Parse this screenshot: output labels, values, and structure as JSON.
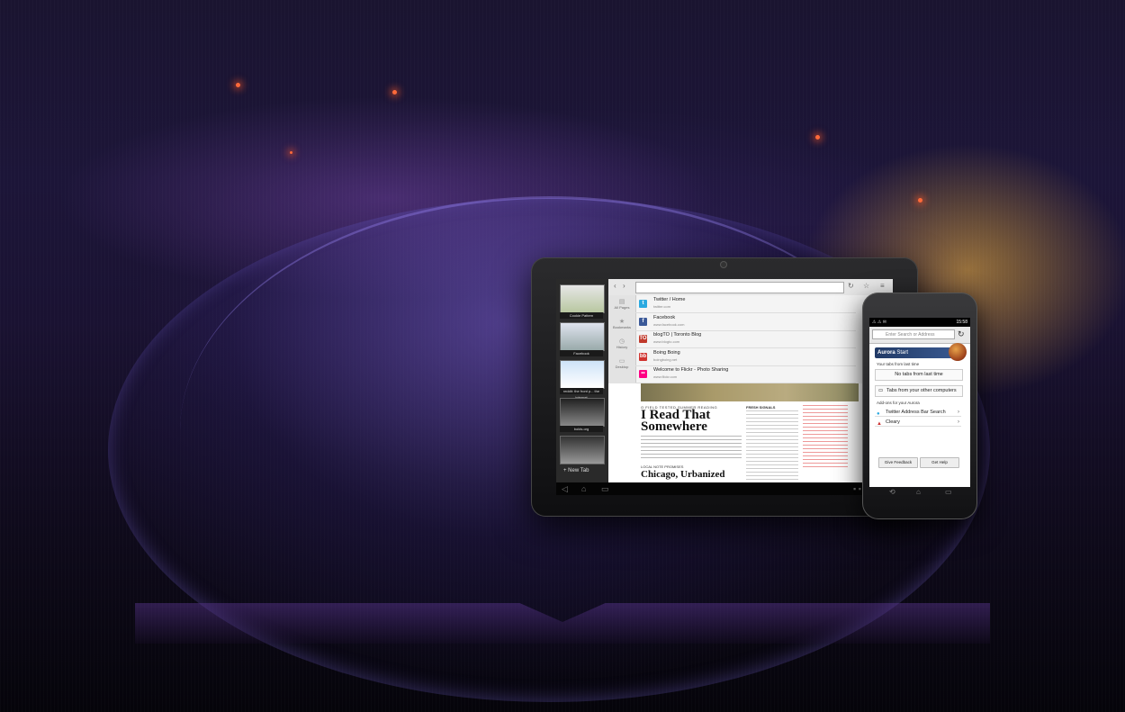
{
  "tablet": {
    "tabs": [
      {
        "caption": "Cookie Pattern"
      },
      {
        "caption": "Facebook"
      },
      {
        "caption": "reddit: the front p... the internet"
      },
      {
        "caption": "bolds.org"
      }
    ],
    "new_tab_label": "New Tab",
    "url_value": "",
    "sidebar": [
      {
        "label": "All Pages",
        "icon": "pages-icon"
      },
      {
        "label": "Bookmarks",
        "icon": "star-icon"
      },
      {
        "label": "History",
        "icon": "clock-icon"
      },
      {
        "label": "Desktop",
        "icon": "monitor-icon"
      }
    ],
    "suggestions": [
      {
        "title": "Twitter / Home",
        "url": "twitter.com",
        "color": "#2aa9e0",
        "glyph": "t"
      },
      {
        "title": "Facebook",
        "url": "www.facebook.com",
        "color": "#3b5998",
        "glyph": "f"
      },
      {
        "title": "blogTO | Toronto Blog",
        "url": "www.blogto.com",
        "color": "#c0392b",
        "glyph": "TO"
      },
      {
        "title": "Boing Boing",
        "url": "boingboing.net",
        "color": "#d0332f",
        "glyph": "bb"
      },
      {
        "title": "Welcome to Flickr - Photo Sharing",
        "url": "www.flickr.com",
        "color": "#ff0084",
        "glyph": "••"
      }
    ],
    "article": {
      "kicker": "O FIELD TESTED SUMMER READING",
      "headline": "I Read That Somewhere",
      "kicker2": "LOCAL NOTE PROMISES",
      "headline2": "Chicago, Urbanized",
      "side_title": "FRESH SIGNALS"
    }
  },
  "phone": {
    "status_time": "15:58",
    "url_placeholder": "Enter Search or Address",
    "banner_bold": "Aurora",
    "banner_rest": " Start",
    "last_time_label": "Your tabs from last time",
    "no_tabs": "No tabs from last time",
    "other_computers": "Tabs from your other computers",
    "addons_label": "Add-ons for your Aurora",
    "addons": [
      {
        "name": "Twitter Address Bar Search"
      },
      {
        "name": "Cleary"
      }
    ],
    "feedback_button": "Give Feedback",
    "help_button": "Get Help"
  }
}
